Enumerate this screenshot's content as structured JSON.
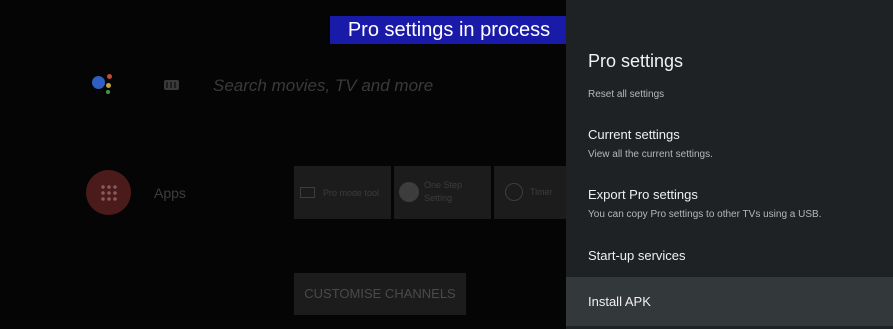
{
  "banner": {
    "text": "Pro settings in process"
  },
  "launcher": {
    "search_placeholder": "Search movies, TV and more",
    "apps_label": "Apps",
    "tiles": [
      {
        "label": "Pro mode tool"
      },
      {
        "label_line1": "One Step",
        "label_line2": "Setting"
      },
      {
        "label": "Timer"
      }
    ],
    "customise_button": "CUSTOMISE CHANNELS",
    "icons": [
      "google-assistant-icon",
      "keyboard-icon",
      "apps-grid-icon",
      "tv-icon",
      "wrench-icon",
      "clock-icon"
    ]
  },
  "panel": {
    "title": "Pro settings",
    "items": [
      {
        "title": "",
        "subtitle": "Reset all settings"
      },
      {
        "title": "Current settings",
        "subtitle": "View all the current settings."
      },
      {
        "title": "Export Pro settings",
        "subtitle": "You can copy Pro settings to other TVs using a USB."
      },
      {
        "title": "Start-up services",
        "subtitle": ""
      },
      {
        "title": "Install APK",
        "subtitle": "",
        "selected": true
      }
    ]
  },
  "colors": {
    "banner_bg": "#1a1aa8",
    "panel_bg": "#1e2224",
    "selected_bg": "#33383b",
    "apps_circle": "#4b1a1a"
  }
}
